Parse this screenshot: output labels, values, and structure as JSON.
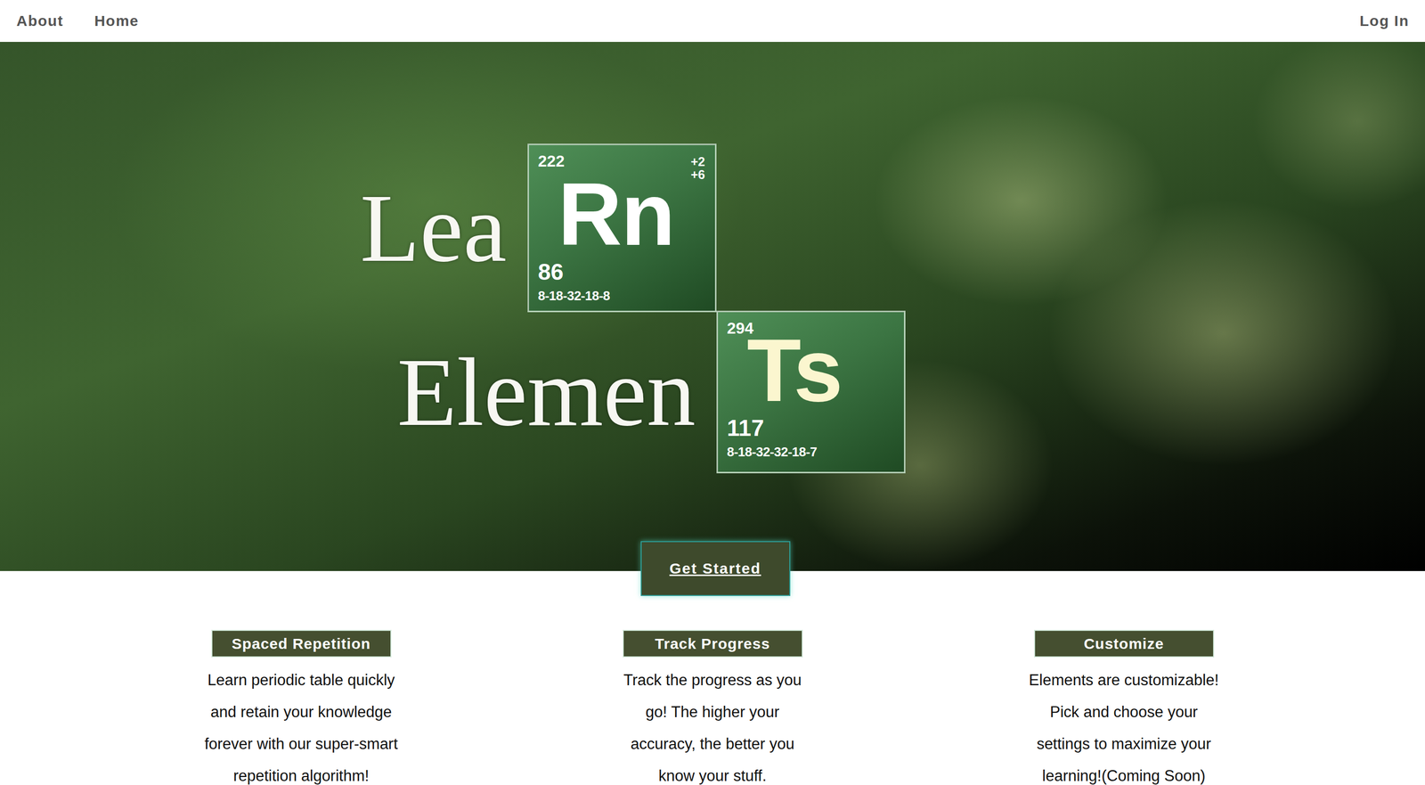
{
  "nav": {
    "left": [
      "About",
      "Home"
    ],
    "right": "Log In"
  },
  "logo": [
    {
      "word": "Lea",
      "tile": {
        "mass": "222",
        "charges": [
          "+2",
          "+6"
        ],
        "symbol": "Rn",
        "number": "86",
        "config": "8-18-32-18-8",
        "color": "#ffffff"
      }
    },
    {
      "word": "Elemen",
      "tile": {
        "mass": "294",
        "charges": [],
        "symbol": "Ts",
        "number": "117",
        "config": "8-18-32-32-18-7",
        "color": "#fbf6cf"
      }
    }
  ],
  "cta": "Get Started",
  "features": [
    {
      "title": "Spaced Repetition",
      "text": "Learn periodic table quickly and retain your knowledge forever with our super-smart repetition algorithm!"
    },
    {
      "title": "Track Progress",
      "text": "Track the progress as you go! The higher your accuracy, the better you know your stuff."
    },
    {
      "title": "Customize",
      "text": "Elements are customizable! Pick and choose your settings to maximize your learning!(Coming Soon)"
    }
  ]
}
